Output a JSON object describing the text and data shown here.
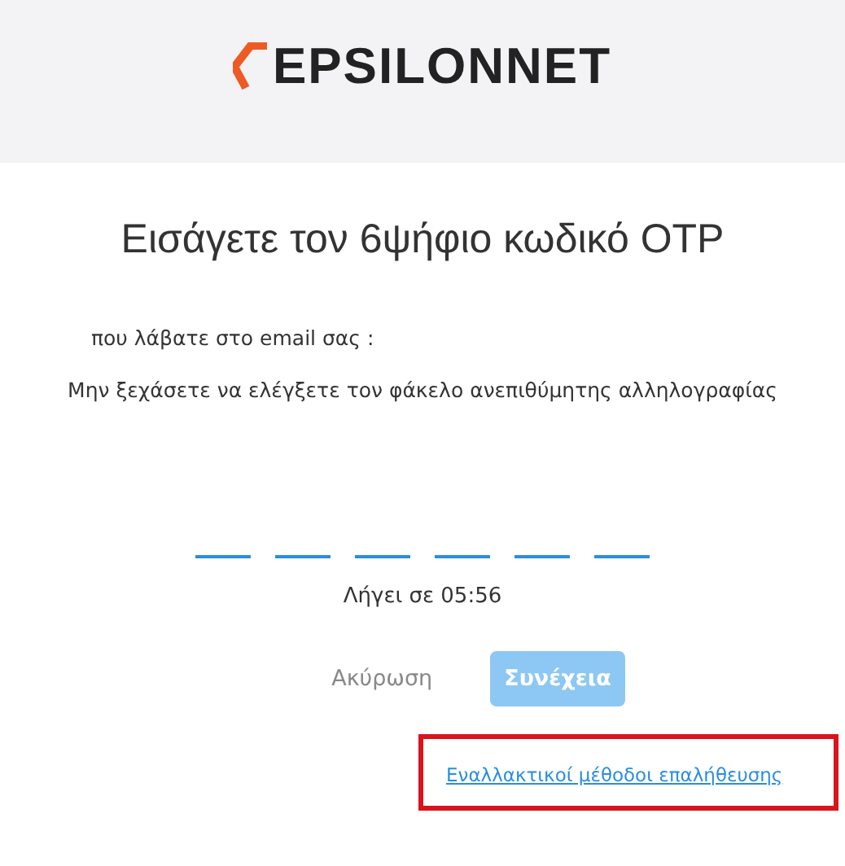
{
  "header": {
    "logo_text": "EPSILONNET"
  },
  "title": "Εισάγετε τον 6ψήφιο κωδικό OTP",
  "subtitle": "που λάβατε στο email σας :",
  "notice": "Μην ξεχάσετε να ελέγξετε τον φάκελο ανεπιθύμητης αλληλογραφίας",
  "otp_digits": [
    {
      "filled": false
    },
    {
      "filled": false
    },
    {
      "filled": false
    },
    {
      "filled": false
    },
    {
      "filled": false
    },
    {
      "filled": false
    }
  ],
  "timer": "Λήγει σε 05:56",
  "buttons": [
    {
      "label": "Ακύρωση",
      "kind": "text",
      "disabled": false
    },
    {
      "label": "Συνέχεια",
      "kind": "primary",
      "disabled": true
    }
  ],
  "alt_link": {
    "label": "Εναλλακτικοί μέθοδοι επαλήθευσης",
    "highlighted": true
  }
}
